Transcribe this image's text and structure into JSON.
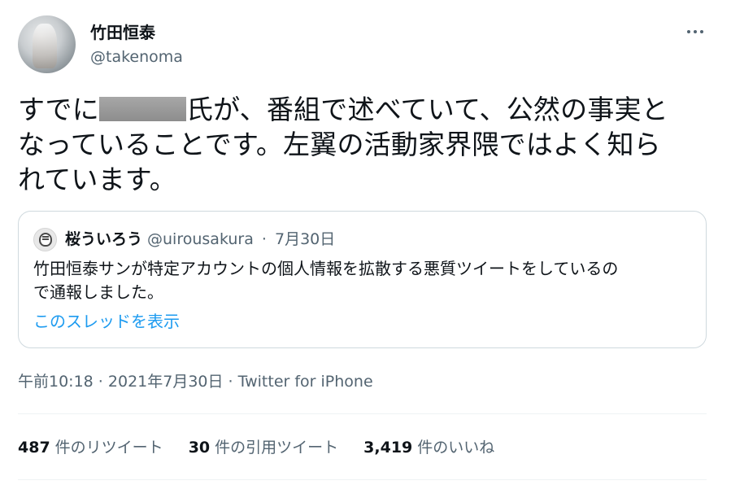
{
  "author": {
    "display_name": "竹田恒泰",
    "handle": "@takenoma"
  },
  "body": {
    "line1_before": "すでに",
    "line1_after": "氏が、番組で述べていて、公然の事実と",
    "line2": "なっていることです。左翼の活動家界隈ではよく知ら",
    "line3": "れています。"
  },
  "quote": {
    "display_name": "桜ういろう",
    "handle": "@uirousakura",
    "separator": "·",
    "date": "7月30日",
    "text_line1": "竹田恒泰サンが特定アカウントの個人情報を拡散する悪質ツイートをしているの",
    "text_line2": "で通報しました。",
    "thread_link": "このスレッドを表示"
  },
  "meta": {
    "time": "午前10:18",
    "sep1": " · ",
    "date": "2021年7月30日",
    "sep2": " · ",
    "source": "Twitter for iPhone"
  },
  "stats": {
    "retweets_count": "487",
    "retweets_label": "件のリツイート",
    "quotes_count": "30",
    "quotes_label": "件の引用ツイート",
    "likes_count": "3,419",
    "likes_label": "件のいいね"
  },
  "colors": {
    "text": "#0f1419",
    "secondary": "#536471",
    "link": "#1d9bf0",
    "border": "#cfd9de",
    "redaction": "#9a9a9a"
  },
  "icons": [
    "more-horizontal-icon"
  ]
}
